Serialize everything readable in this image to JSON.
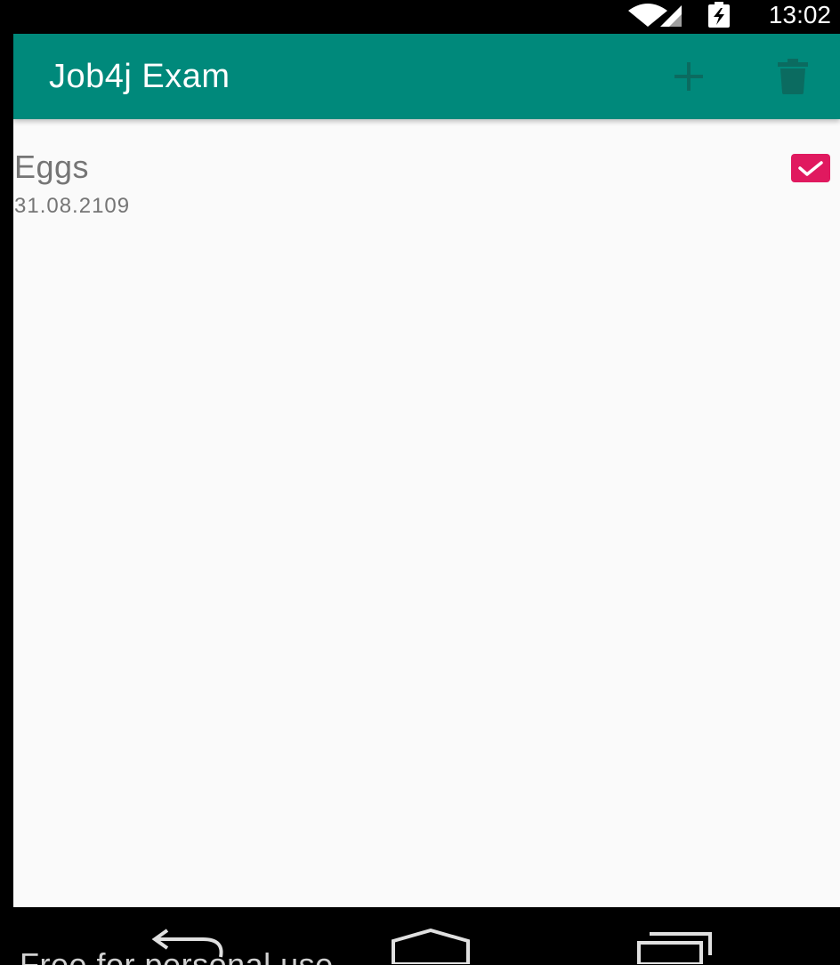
{
  "status_bar": {
    "time": "13:02",
    "icons": [
      "wifi-icon",
      "signal-icon",
      "battery-charging-icon"
    ]
  },
  "toolbar": {
    "title": "Job4j Exam",
    "actions": [
      {
        "name": "add",
        "icon": "plus-icon"
      },
      {
        "name": "delete",
        "icon": "trash-icon"
      }
    ],
    "color": "#00897b"
  },
  "list": {
    "items": [
      {
        "title": "Eggs",
        "date": "31.08.2109",
        "checked": true
      }
    ]
  },
  "nav_bar": {
    "buttons": [
      "back-icon",
      "home-icon",
      "recents-icon"
    ]
  },
  "watermark": "Free for personal use",
  "colors": {
    "accent": "#e0195f",
    "background": "#fafafa",
    "text_secondary": "#757575"
  }
}
